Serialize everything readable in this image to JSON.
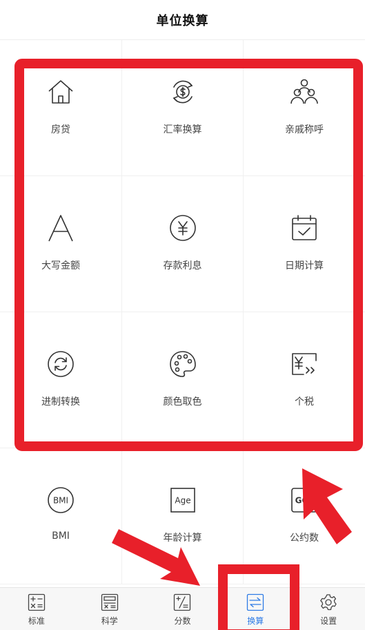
{
  "header": {
    "title": "单位换算"
  },
  "grid_items": [
    {
      "label": "房贷",
      "icon": "house-icon"
    },
    {
      "label": "汇率换算",
      "icon": "currency-exchange-icon"
    },
    {
      "label": "亲戚称呼",
      "icon": "family-icon"
    },
    {
      "label": "大写金额",
      "icon": "letter-a-icon"
    },
    {
      "label": "存款利息",
      "icon": "yen-coin-icon"
    },
    {
      "label": "日期计算",
      "icon": "calendar-check-icon"
    },
    {
      "label": "进制转换",
      "icon": "refresh-icon"
    },
    {
      "label": "颜色取色",
      "icon": "palette-icon"
    },
    {
      "label": "个税",
      "icon": "tax-icon"
    },
    {
      "label": "BMI",
      "icon": "bmi-icon",
      "icon_text": "BMI"
    },
    {
      "label": "年龄计算",
      "icon": "age-icon",
      "icon_text": "Age"
    },
    {
      "label": "公约数",
      "icon": "gcd-icon",
      "icon_text": "GC"
    }
  ],
  "tabs": [
    {
      "label": "标准",
      "icon": "standard-calculator-icon",
      "active": false
    },
    {
      "label": "科学",
      "icon": "scientific-calculator-icon",
      "active": false
    },
    {
      "label": "分数",
      "icon": "fraction-icon",
      "active": false
    },
    {
      "label": "换算",
      "icon": "convert-icon",
      "active": true
    },
    {
      "label": "设置",
      "icon": "gear-icon",
      "active": false
    }
  ],
  "colors": {
    "accent": "#2e7be6",
    "annotation_red": "#e8202a",
    "icon_stroke": "#333333"
  }
}
